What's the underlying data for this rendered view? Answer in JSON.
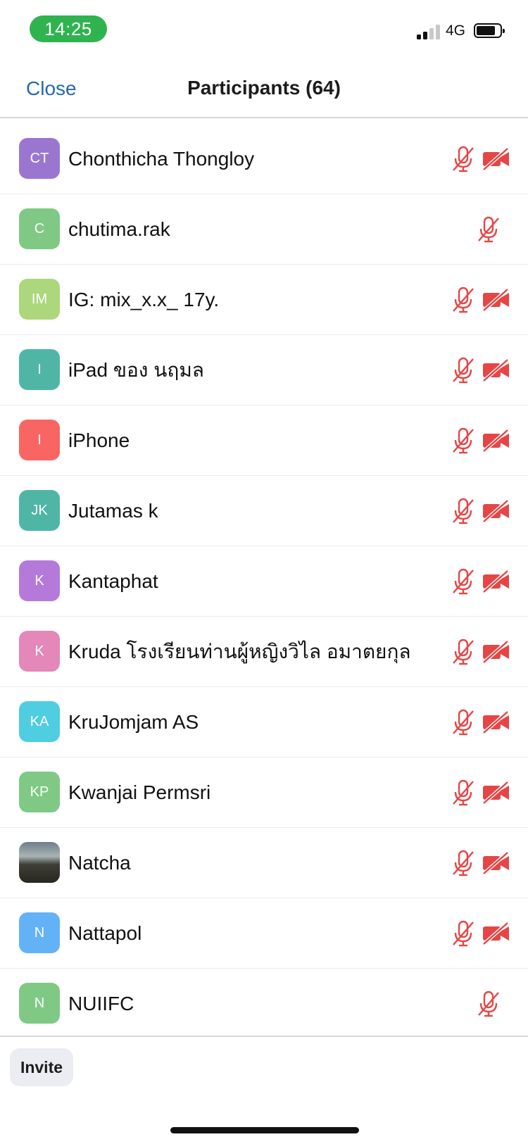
{
  "status_bar": {
    "time": "14:25",
    "network": "4G",
    "time_pill_color": "#2fb34f",
    "signal_bars_active": 2,
    "signal_bars_total": 4
  },
  "navbar": {
    "close_label": "Close",
    "title": "Participants (64)",
    "accent_color": "#2668b0"
  },
  "muted_color": "#e64545",
  "participants": [
    {
      "initials": "CT",
      "name": "Chonthicha Thongloy",
      "avatar_color": "#9a76d1",
      "mic_muted": true,
      "video_off": true
    },
    {
      "initials": "C",
      "name": "chutima.rak",
      "avatar_color": "#7fc984",
      "mic_muted": true,
      "video_off": false
    },
    {
      "initials": "IM",
      "name": "IG: mix_x.x_ 17y.",
      "avatar_color": "#acd77c",
      "mic_muted": true,
      "video_off": true
    },
    {
      "initials": "I",
      "name": "iPad ของ นฤมล",
      "avatar_color": "#4fb6a5",
      "mic_muted": true,
      "video_off": true
    },
    {
      "initials": "I",
      "name": "iPhone",
      "avatar_color": "#f86563",
      "mic_muted": true,
      "video_off": true
    },
    {
      "initials": "JK",
      "name": "Jutamas k",
      "avatar_color": "#4fb6a5",
      "mic_muted": true,
      "video_off": true
    },
    {
      "initials": "K",
      "name": "Kantaphat",
      "avatar_color": "#b57ad9",
      "mic_muted": true,
      "video_off": true
    },
    {
      "initials": "K",
      "name": "Kruda โรงเรียนท่านผู้หญิงวิไล อมาตยกุล",
      "avatar_color": "#e487b9",
      "mic_muted": true,
      "video_off": true
    },
    {
      "initials": "KA",
      "name": "KruJomjam AS",
      "avatar_color": "#4fcde1",
      "mic_muted": true,
      "video_off": true
    },
    {
      "initials": "KP",
      "name": "Kwanjai Permsri",
      "avatar_color": "#7fc984",
      "mic_muted": true,
      "video_off": true
    },
    {
      "initials": "",
      "name": "Natcha",
      "avatar_color": "#555555",
      "avatar_photo": true,
      "mic_muted": true,
      "video_off": true
    },
    {
      "initials": "N",
      "name": "Nattapol",
      "avatar_color": "#63b2f6",
      "mic_muted": true,
      "video_off": true
    },
    {
      "initials": "N",
      "name": "NUIIFC",
      "avatar_color": "#7fc984",
      "mic_muted": true,
      "video_off": false
    }
  ],
  "bottom_bar": {
    "invite_label": "Invite"
  }
}
